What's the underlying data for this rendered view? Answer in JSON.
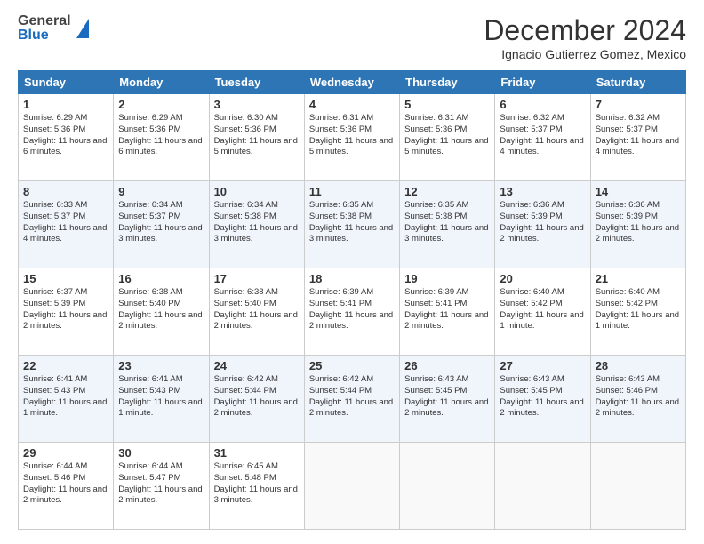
{
  "header": {
    "logo_line1": "General",
    "logo_line2": "Blue",
    "main_title": "December 2024",
    "subtitle": "Ignacio Gutierrez Gomez, Mexico"
  },
  "calendar": {
    "days_of_week": [
      "Sunday",
      "Monday",
      "Tuesday",
      "Wednesday",
      "Thursday",
      "Friday",
      "Saturday"
    ],
    "weeks": [
      [
        {
          "day": "1",
          "sunrise": "6:29 AM",
          "sunset": "5:36 PM",
          "daylight": "11 hours and 6 minutes."
        },
        {
          "day": "2",
          "sunrise": "6:29 AM",
          "sunset": "5:36 PM",
          "daylight": "11 hours and 6 minutes."
        },
        {
          "day": "3",
          "sunrise": "6:30 AM",
          "sunset": "5:36 PM",
          "daylight": "11 hours and 5 minutes."
        },
        {
          "day": "4",
          "sunrise": "6:31 AM",
          "sunset": "5:36 PM",
          "daylight": "11 hours and 5 minutes."
        },
        {
          "day": "5",
          "sunrise": "6:31 AM",
          "sunset": "5:36 PM",
          "daylight": "11 hours and 5 minutes."
        },
        {
          "day": "6",
          "sunrise": "6:32 AM",
          "sunset": "5:37 PM",
          "daylight": "11 hours and 4 minutes."
        },
        {
          "day": "7",
          "sunrise": "6:32 AM",
          "sunset": "5:37 PM",
          "daylight": "11 hours and 4 minutes."
        }
      ],
      [
        {
          "day": "8",
          "sunrise": "6:33 AM",
          "sunset": "5:37 PM",
          "daylight": "11 hours and 4 minutes."
        },
        {
          "day": "9",
          "sunrise": "6:34 AM",
          "sunset": "5:37 PM",
          "daylight": "11 hours and 3 minutes."
        },
        {
          "day": "10",
          "sunrise": "6:34 AM",
          "sunset": "5:38 PM",
          "daylight": "11 hours and 3 minutes."
        },
        {
          "day": "11",
          "sunrise": "6:35 AM",
          "sunset": "5:38 PM",
          "daylight": "11 hours and 3 minutes."
        },
        {
          "day": "12",
          "sunrise": "6:35 AM",
          "sunset": "5:38 PM",
          "daylight": "11 hours and 3 minutes."
        },
        {
          "day": "13",
          "sunrise": "6:36 AM",
          "sunset": "5:39 PM",
          "daylight": "11 hours and 2 minutes."
        },
        {
          "day": "14",
          "sunrise": "6:36 AM",
          "sunset": "5:39 PM",
          "daylight": "11 hours and 2 minutes."
        }
      ],
      [
        {
          "day": "15",
          "sunrise": "6:37 AM",
          "sunset": "5:39 PM",
          "daylight": "11 hours and 2 minutes."
        },
        {
          "day": "16",
          "sunrise": "6:38 AM",
          "sunset": "5:40 PM",
          "daylight": "11 hours and 2 minutes."
        },
        {
          "day": "17",
          "sunrise": "6:38 AM",
          "sunset": "5:40 PM",
          "daylight": "11 hours and 2 minutes."
        },
        {
          "day": "18",
          "sunrise": "6:39 AM",
          "sunset": "5:41 PM",
          "daylight": "11 hours and 2 minutes."
        },
        {
          "day": "19",
          "sunrise": "6:39 AM",
          "sunset": "5:41 PM",
          "daylight": "11 hours and 2 minutes."
        },
        {
          "day": "20",
          "sunrise": "6:40 AM",
          "sunset": "5:42 PM",
          "daylight": "11 hours and 1 minute."
        },
        {
          "day": "21",
          "sunrise": "6:40 AM",
          "sunset": "5:42 PM",
          "daylight": "11 hours and 1 minute."
        }
      ],
      [
        {
          "day": "22",
          "sunrise": "6:41 AM",
          "sunset": "5:43 PM",
          "daylight": "11 hours and 1 minute."
        },
        {
          "day": "23",
          "sunrise": "6:41 AM",
          "sunset": "5:43 PM",
          "daylight": "11 hours and 1 minute."
        },
        {
          "day": "24",
          "sunrise": "6:42 AM",
          "sunset": "5:44 PM",
          "daylight": "11 hours and 2 minutes."
        },
        {
          "day": "25",
          "sunrise": "6:42 AM",
          "sunset": "5:44 PM",
          "daylight": "11 hours and 2 minutes."
        },
        {
          "day": "26",
          "sunrise": "6:43 AM",
          "sunset": "5:45 PM",
          "daylight": "11 hours and 2 minutes."
        },
        {
          "day": "27",
          "sunrise": "6:43 AM",
          "sunset": "5:45 PM",
          "daylight": "11 hours and 2 minutes."
        },
        {
          "day": "28",
          "sunrise": "6:43 AM",
          "sunset": "5:46 PM",
          "daylight": "11 hours and 2 minutes."
        }
      ],
      [
        {
          "day": "29",
          "sunrise": "6:44 AM",
          "sunset": "5:46 PM",
          "daylight": "11 hours and 2 minutes."
        },
        {
          "day": "30",
          "sunrise": "6:44 AM",
          "sunset": "5:47 PM",
          "daylight": "11 hours and 2 minutes."
        },
        {
          "day": "31",
          "sunrise": "6:45 AM",
          "sunset": "5:48 PM",
          "daylight": "11 hours and 3 minutes."
        },
        null,
        null,
        null,
        null
      ]
    ]
  }
}
